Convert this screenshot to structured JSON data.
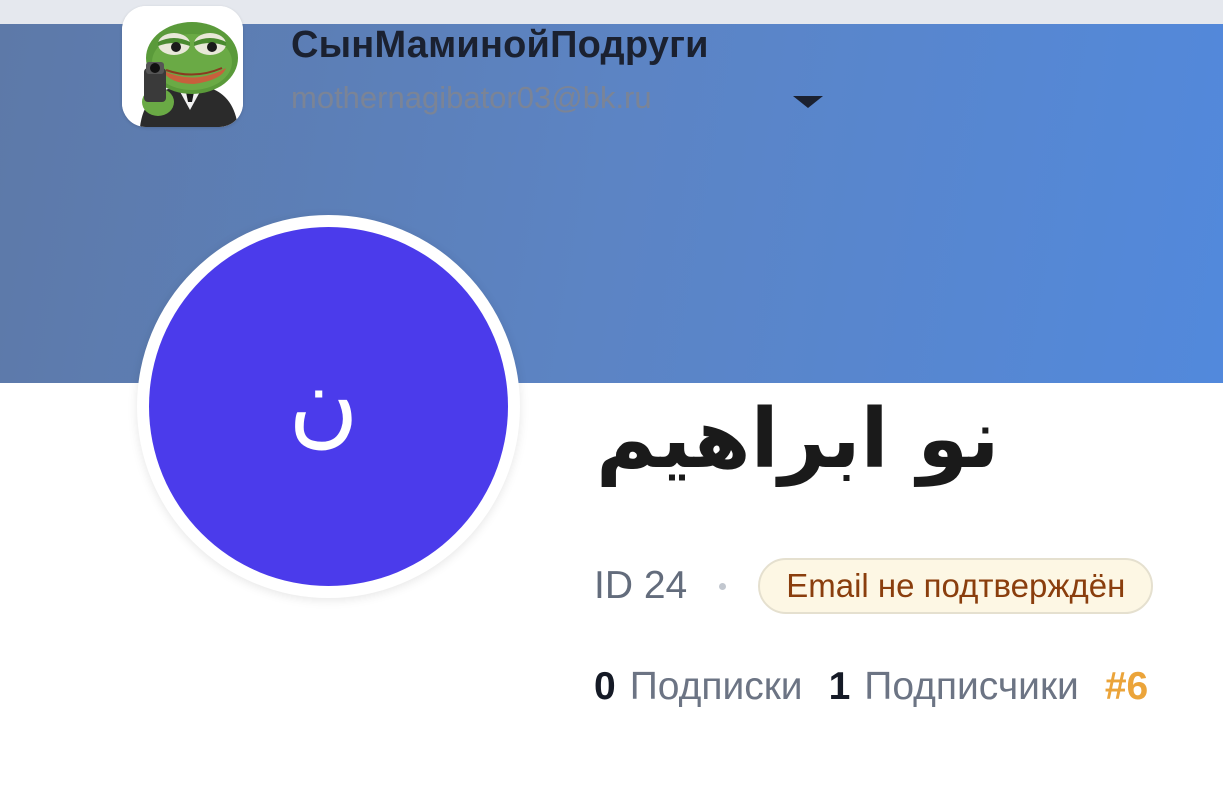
{
  "account_switcher": {
    "name": "СынМаминойПодруги",
    "email": "mothernagibator03@bk.ru",
    "dropdown_icon": "triangle-down-icon",
    "avatar_icon": "frog-avatar-icon"
  },
  "profile": {
    "avatar_letter": "ن",
    "avatar_color": "#4b3beb",
    "name": "نو ابراهيم",
    "id_text": "ID 24",
    "email_status": "Email не подтверждён"
  },
  "stats": {
    "following_count": "0",
    "following_label": "Подписки",
    "followers_count": "1",
    "followers_label": "Подписчики",
    "rank": "#6"
  },
  "colors": {
    "cover_gradient_start": "#5d79a8",
    "cover_gradient_end": "#5289dc",
    "rank_color": "#eba43a",
    "badge_bg": "#fdf7e4",
    "badge_text": "#8a3e0d"
  }
}
